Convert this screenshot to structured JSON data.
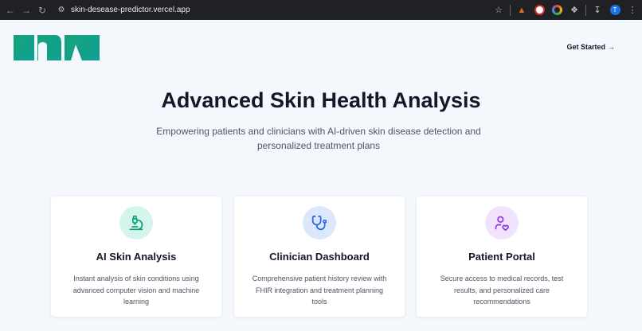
{
  "browser": {
    "url": "skin-desease-predictor.vercel.app",
    "profile_initial": "T",
    "icons": [
      "back-arrow-icon",
      "forward-arrow-icon",
      "reload-icon",
      "site-info-icon",
      "bookmark-star-icon",
      "extension-fox-icon",
      "extension-red-icon",
      "extension-color-ring-icon",
      "extensions-puzzle-icon",
      "download-icon",
      "more-menu-icon"
    ]
  },
  "header": {
    "get_started": "Get Started"
  },
  "hero": {
    "title": "Advanced Skin Health Analysis",
    "subtitle": "Empowering patients and clinicians with AI-driven skin disease detection and personalized treatment plans"
  },
  "cards": [
    {
      "title": "AI Skin Analysis",
      "description": "Instant analysis of skin conditions using advanced computer vision and machine learning",
      "icon": "microscope-icon",
      "icon_color": "#0f9f80",
      "icon_bg": "#d4f5ec"
    },
    {
      "title": "Clinician Dashboard",
      "description": "Comprehensive patient history review with FHIR integration and treatment planning tools",
      "icon": "stethoscope-icon",
      "icon_color": "#2563eb",
      "icon_bg": "#dbe8fc"
    },
    {
      "title": "Patient Portal",
      "description": "Secure access to medical records, test results, and personalized care recommendations",
      "icon": "user-heart-icon",
      "icon_color": "#9333ea",
      "icon_bg": "#f1e3fb"
    }
  ],
  "colors": {
    "logo_gradient_start": "#16a37a",
    "logo_gradient_end": "#0f9f93",
    "page_bg": "#f4f8fd"
  }
}
